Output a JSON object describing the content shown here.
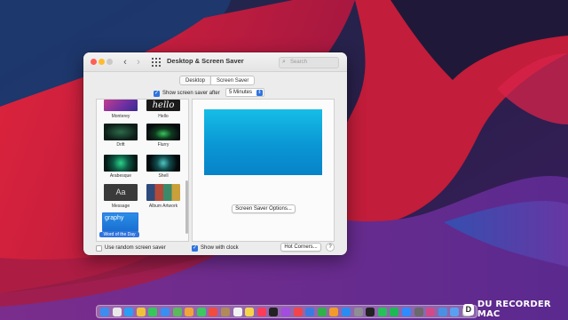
{
  "window": {
    "title": "Desktop & Screen Saver",
    "search_placeholder": "Search",
    "nav_back": "‹",
    "nav_forward": "›"
  },
  "tabs": [
    {
      "label": "Desktop",
      "active": false
    },
    {
      "label": "Screen Saver",
      "active": true
    }
  ],
  "show_after": {
    "label": "Show screen saver after",
    "checked": true,
    "selected_value": "5 Minutes",
    "popup_arrow": "⇕"
  },
  "screensavers": [
    {
      "name": "Monterey",
      "icon": "monterey-thumbnail"
    },
    {
      "name": "Hello",
      "icon": "hello-thumbnail",
      "thumb_text": "hello"
    },
    {
      "name": "Drift",
      "icon": "drift-thumbnail"
    },
    {
      "name": "Flurry",
      "icon": "flurry-thumbnail"
    },
    {
      "name": "Arabesque",
      "icon": "arabesque-thumbnail"
    },
    {
      "name": "Shell",
      "icon": "shell-thumbnail"
    },
    {
      "name": "Message",
      "icon": "message-thumbnail",
      "thumb_text": "Aa"
    },
    {
      "name": "Album Artwork",
      "icon": "album-artwork-thumbnail"
    },
    {
      "name": "Word of the Day",
      "icon": "word-of-the-day-thumbnail",
      "selected": true,
      "thumb_text": "graphy"
    }
  ],
  "preview": {
    "options_button": "Screen Saver Options..."
  },
  "bottom": {
    "random_label": "Use random screen saver",
    "random_checked": false,
    "clock_label": "Show with clock",
    "clock_checked": true,
    "hot_corners_button": "Hot Corners...",
    "help_button": "?"
  },
  "colors": {
    "accent": "#2f74de",
    "preview_blue": "#0a96d4",
    "selection": "#2f74de"
  },
  "dock": {
    "icons": [
      "finder-icon",
      "launchpad-icon",
      "safari-icon",
      "chrome-icon",
      "messages-icon",
      "mail-icon",
      "maps-icon",
      "photos-icon",
      "facetime-icon",
      "calendar-icon",
      "contacts-icon",
      "reminders-icon",
      "notes-icon",
      "music-icon",
      "appletv-icon",
      "podcasts-icon",
      "news-icon",
      "keynote-icon",
      "numbers-icon",
      "pages-icon",
      "appstore-icon",
      "settings-icon",
      "terminal-icon",
      "whatsapp-icon",
      "spotify-icon",
      "zoom-icon",
      "app-icon",
      "app-icon",
      "app-icon",
      "downloads-icon",
      "trash-icon"
    ]
  },
  "watermark": {
    "text": "DU RECORDER MAC",
    "logo_glyph": "D"
  }
}
